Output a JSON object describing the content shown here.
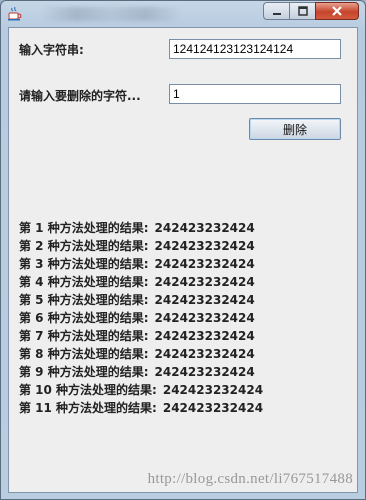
{
  "window": {
    "icon": "java-coffee-cup-icon",
    "buttons": {
      "minimize": "minimize-icon",
      "maximize": "maximize-icon",
      "close": "close-icon"
    }
  },
  "form": {
    "input_label": "输入字符串:",
    "input_value": "124124123123124124",
    "delete_label": "请输入要删除的字符...",
    "delete_value": "1",
    "delete_button": "删除"
  },
  "results": [
    {
      "label": "第 1 种方法处理的结果:",
      "value": "242423232424"
    },
    {
      "label": "第 2 种方法处理的结果:",
      "value": "242423232424"
    },
    {
      "label": "第 3 种方法处理的结果:",
      "value": "242423232424"
    },
    {
      "label": "第 4 种方法处理的结果:",
      "value": "242423232424"
    },
    {
      "label": "第 5 种方法处理的结果:",
      "value": "242423232424"
    },
    {
      "label": "第 6 种方法处理的结果:",
      "value": "242423232424"
    },
    {
      "label": "第 7 种方法处理的结果:",
      "value": "242423232424"
    },
    {
      "label": "第 8 种方法处理的结果:",
      "value": "242423232424"
    },
    {
      "label": "第 9 种方法处理的结果:",
      "value": "242423232424"
    },
    {
      "label": "第 10 种方法处理的结果:",
      "value": "242423232424"
    },
    {
      "label": "第 11 种方法处理的结果:",
      "value": "242423232424"
    }
  ],
  "watermark": "http://blog.csdn.net/li767517488",
  "colors": {
    "close_button": "#c6452c",
    "client_bg": "#eeeeee",
    "frame": "#b9cde1"
  }
}
